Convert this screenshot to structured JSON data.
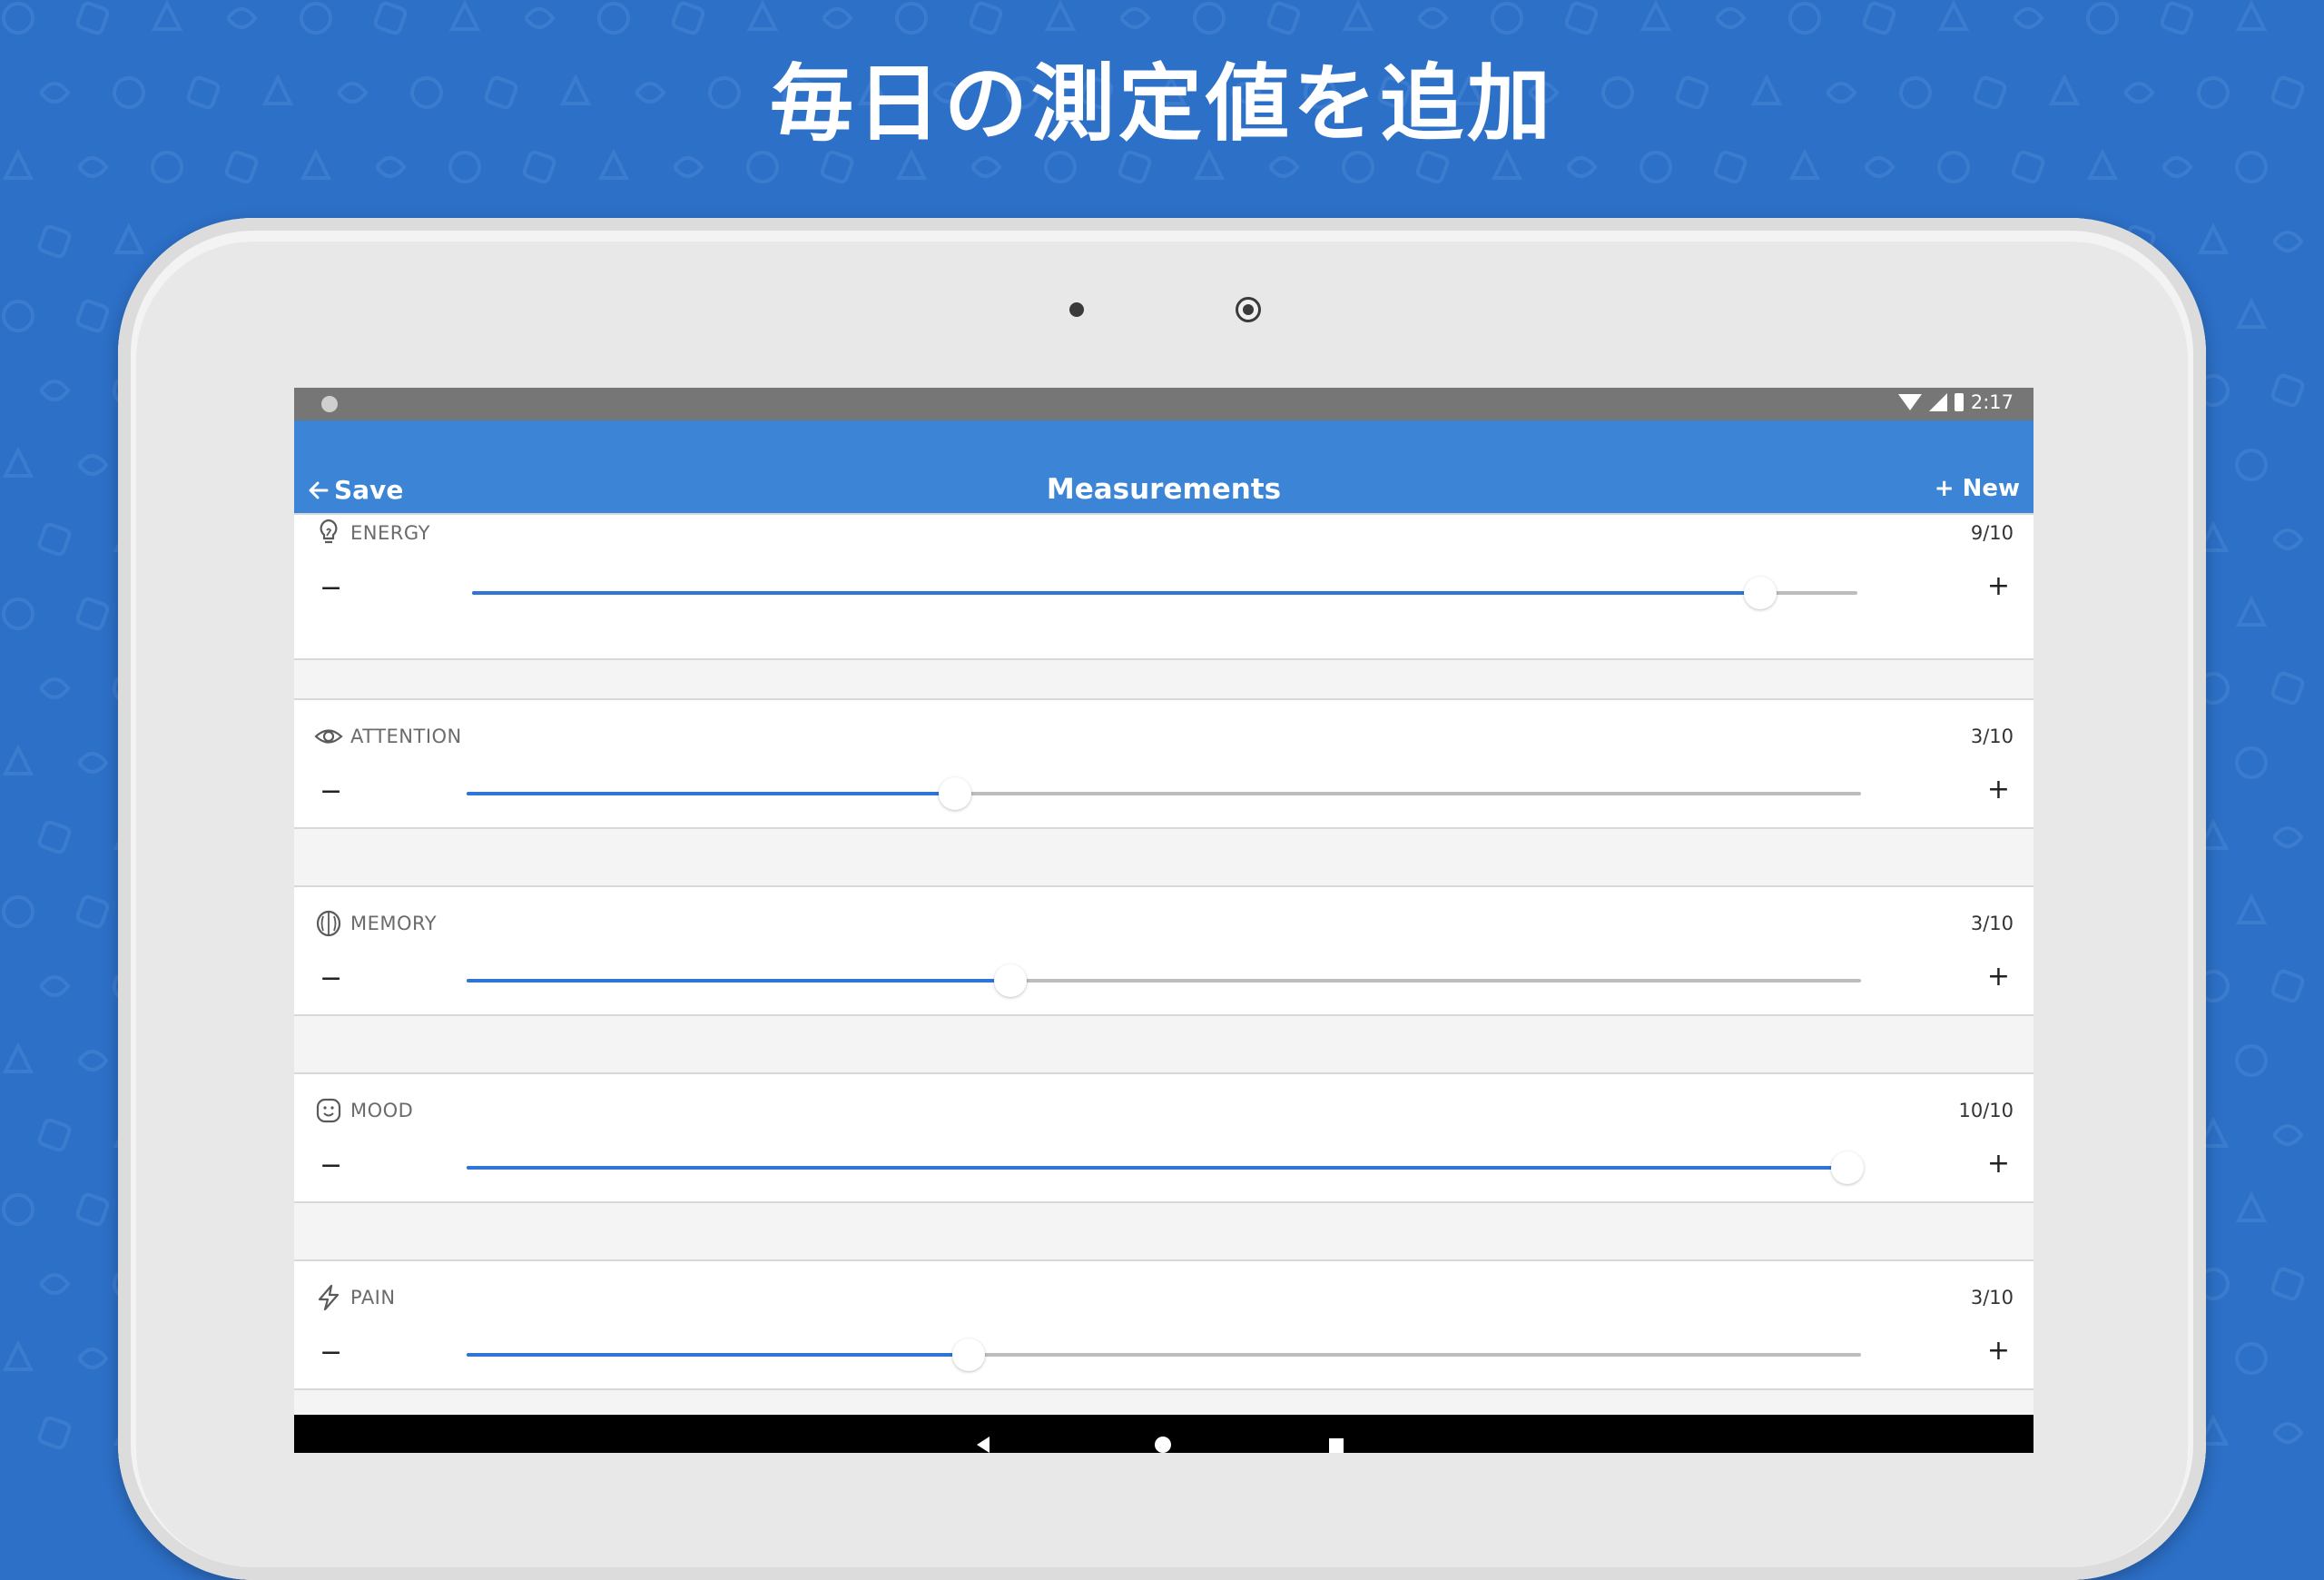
{
  "headline": "毎日の測定値を追加",
  "statusbar": {
    "time": "2:17",
    "icons": [
      "wifi-icon",
      "signal-icon",
      "battery-icon"
    ]
  },
  "appbar": {
    "save_label": "Save",
    "title": "Measurements",
    "new_label": "+ New"
  },
  "measurements": [
    {
      "label": "ENERGY",
      "icon": "lightbulb-icon",
      "value": "9/10",
      "level": 0.93
    },
    {
      "label": "ATTENTION",
      "icon": "eye-icon",
      "value": "3/10",
      "level": 0.35
    },
    {
      "label": "MEMORY",
      "icon": "brain-icon",
      "value": "3/10",
      "level": 0.39
    },
    {
      "label": "MOOD",
      "icon": "smiley-icon",
      "value": "10/10",
      "level": 0.99
    },
    {
      "label": "PAIN",
      "icon": "lightning-icon",
      "value": "3/10",
      "level": 0.36
    }
  ],
  "controls": {
    "minus": "−",
    "plus": "+"
  },
  "colors": {
    "background": "#2d70c8",
    "appbar": "#3b84d6",
    "slider_fill": "#2f74d6"
  }
}
